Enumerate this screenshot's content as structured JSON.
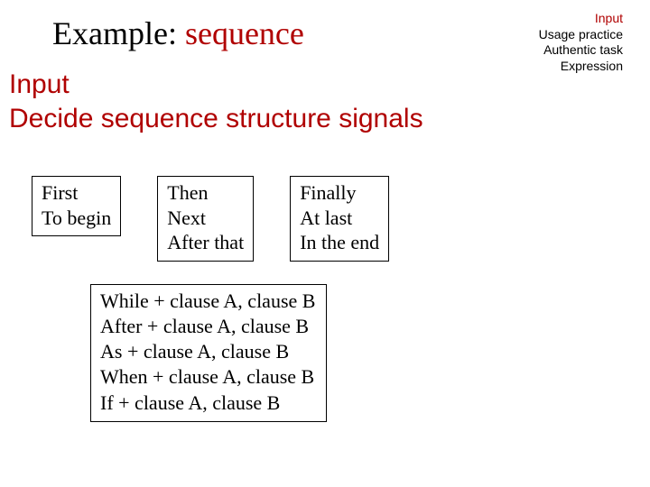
{
  "title": {
    "prefix": "Example: ",
    "highlight": "sequence"
  },
  "topright": {
    "l1": "Input",
    "l2": "Usage practice",
    "l3": "Authentic task",
    "l4": "Expression"
  },
  "section": {
    "l1": "Input",
    "l2": "Decide sequence structure signals"
  },
  "box1": {
    "l1": "First",
    "l2": "To begin"
  },
  "box2": {
    "l1": "Then",
    "l2": "Next",
    "l3": "After that"
  },
  "box3": {
    "l1": "Finally",
    "l2": "At last",
    "l3": "In the end"
  },
  "bigbox": {
    "l1": "While + clause A, clause B",
    "l2": "After + clause A, clause B",
    "l3": "As + clause A, clause B",
    "l4": "When + clause A, clause B",
    "l5": "If + clause A, clause B"
  }
}
